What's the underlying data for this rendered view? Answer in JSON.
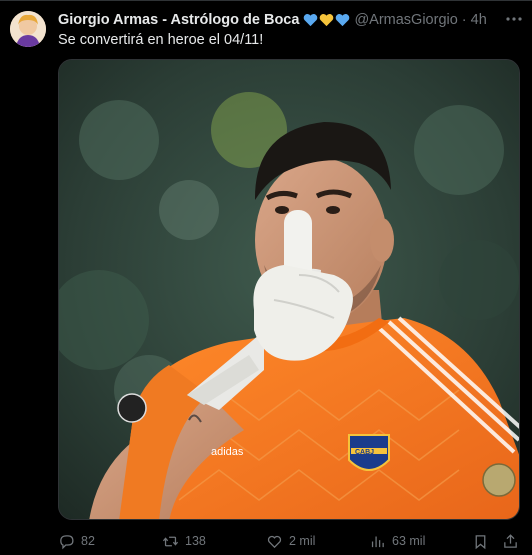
{
  "author": {
    "name": "Giorgio Armas - Astrólogo de Boca",
    "emoji_hearts": [
      "blue-heart",
      "yellow-heart",
      "blue-heart"
    ],
    "handle": "@ArmasGiorgio",
    "separator": "·",
    "time": "4h"
  },
  "tweet": {
    "text": "Se convertirá en heroe el 04/11!"
  },
  "media": {
    "jersey_badge": "CABJ",
    "glove_brand": "adidas"
  },
  "actions": {
    "replies": "82",
    "retweets": "138",
    "likes": "2 mil",
    "views": "63 mil"
  },
  "colors": {
    "background": "#000000",
    "text_primary": "#e7e9ea",
    "text_secondary": "#71767b",
    "heart_blue": "#5aa9f0",
    "heart_yellow": "#f5c33b",
    "jersey_orange": "#f57a1f"
  }
}
